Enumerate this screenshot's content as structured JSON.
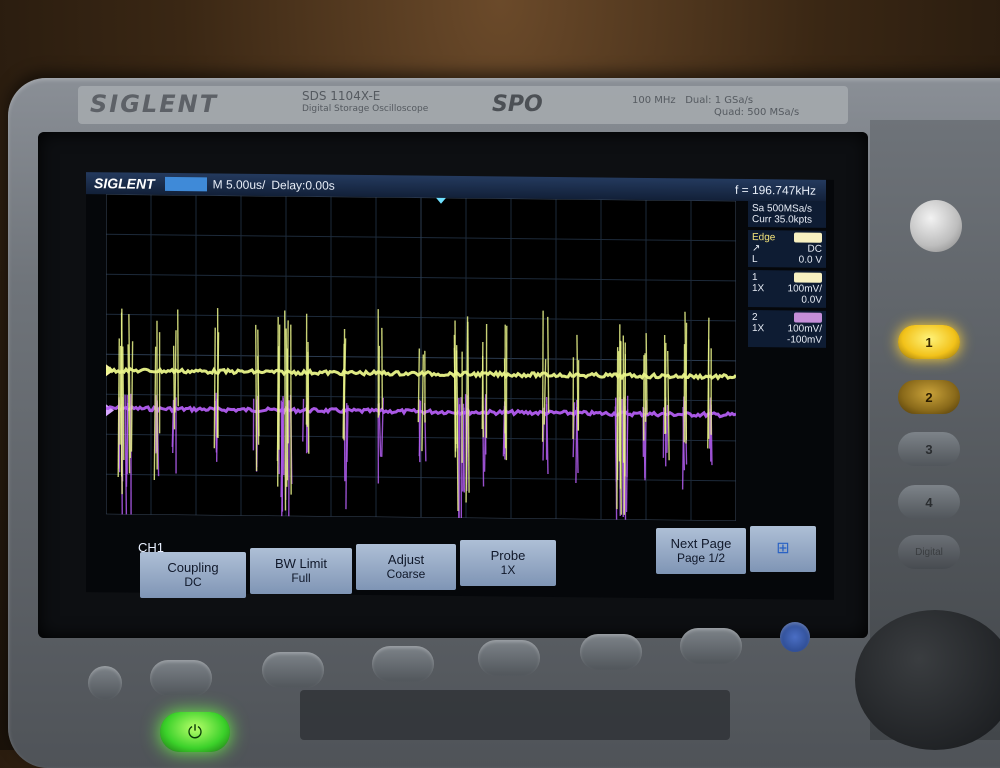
{
  "device": {
    "brand": "SIGLENT",
    "model": "SDS 1104X-E",
    "model_sub": "Digital Storage Oscilloscope",
    "series_logo": "SPO",
    "bandwidth": "100 MHz",
    "sample_dual": "Dual: 1 GSa/s",
    "sample_quad": "Quad: 500 MSa/s"
  },
  "status": {
    "logo": "SIGLENT",
    "timebase": "M 5.00us/",
    "delay": "Delay:0.00s",
    "frequency": "f = 196.747kHz"
  },
  "acquisition": {
    "sample_rate": "Sa 500MSa/s",
    "memory": "Curr 35.0kpts"
  },
  "trigger": {
    "label": "Edge",
    "coupling": "DC",
    "source": "L",
    "level": "0.0 V"
  },
  "channels": [
    {
      "num": "1",
      "probe": "1X",
      "scale": "100mV/",
      "offset": "0.0V",
      "color": "#eaf58a"
    },
    {
      "num": "2",
      "probe": "1X",
      "scale": "100mV/",
      "offset": "-100mV",
      "color": "#b25df0"
    }
  ],
  "menu": {
    "title": "CH1",
    "keys": [
      {
        "line1": "Coupling",
        "line2": "DC"
      },
      {
        "line1": "BW Limit",
        "line2": "Full"
      },
      {
        "line1": "Adjust",
        "line2": "Coarse"
      },
      {
        "line1": "Probe",
        "line2": "1X"
      },
      {
        "line1": "Next Page",
        "line2": "Page 1/2"
      }
    ]
  },
  "side_buttons": [
    "1",
    "2",
    "3",
    "4"
  ],
  "side_label": "Digital"
}
